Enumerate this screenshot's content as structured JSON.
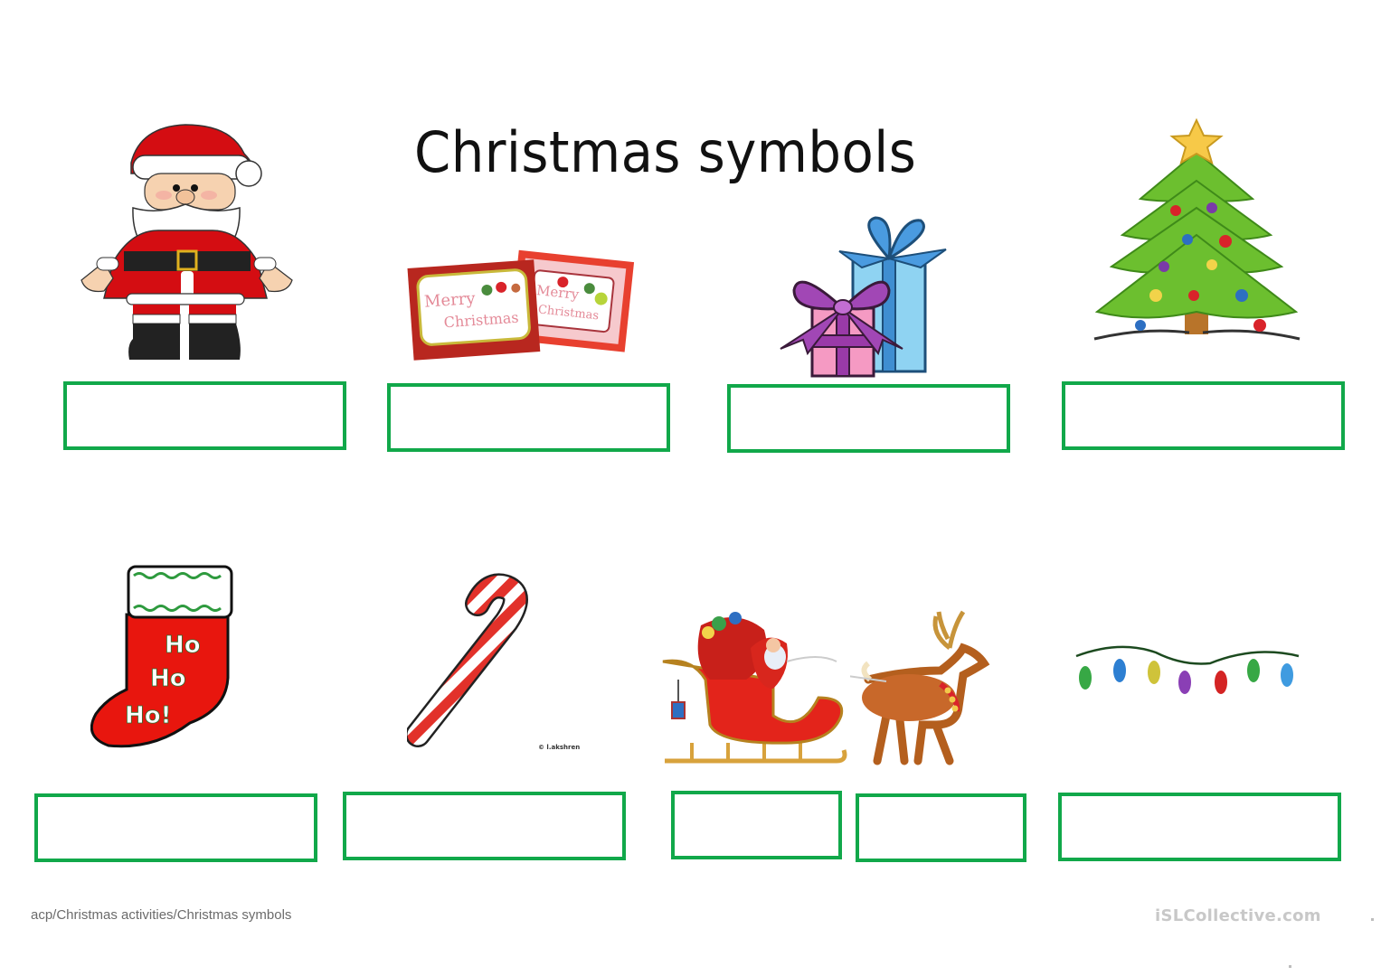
{
  "worksheet": {
    "title": "Christmas symbols",
    "items": [
      {
        "id": "santa",
        "picture": "santa-claus-icon",
        "answer": ""
      },
      {
        "id": "cards",
        "picture": "christmas-cards-icon",
        "answer": "",
        "card_text": [
          "Merry",
          "Christmas"
        ]
      },
      {
        "id": "presents",
        "picture": "presents-icon",
        "answer": ""
      },
      {
        "id": "tree",
        "picture": "christmas-tree-icon",
        "answer": ""
      },
      {
        "id": "stocking",
        "picture": "stocking-icon",
        "answer": "",
        "stocking_text": [
          "Ho",
          "Ho",
          "Ho!"
        ]
      },
      {
        "id": "candy-cane",
        "picture": "candy-cane-icon",
        "answer": "",
        "credit": "© l.akshren"
      },
      {
        "id": "sleigh",
        "picture": "sleigh-icon",
        "answer": ""
      },
      {
        "id": "reindeer",
        "picture": "reindeer-icon",
        "answer": ""
      },
      {
        "id": "lights",
        "picture": "christmas-lights-icon",
        "answer": ""
      }
    ]
  },
  "footer": {
    "path": "acp/Christmas activities/Christmas symbols",
    "brand": "iSLCollective.com"
  },
  "colors": {
    "box_border": "#11a84a",
    "santa_red": "#d40d12",
    "tree_green": "#6cbf2f"
  }
}
